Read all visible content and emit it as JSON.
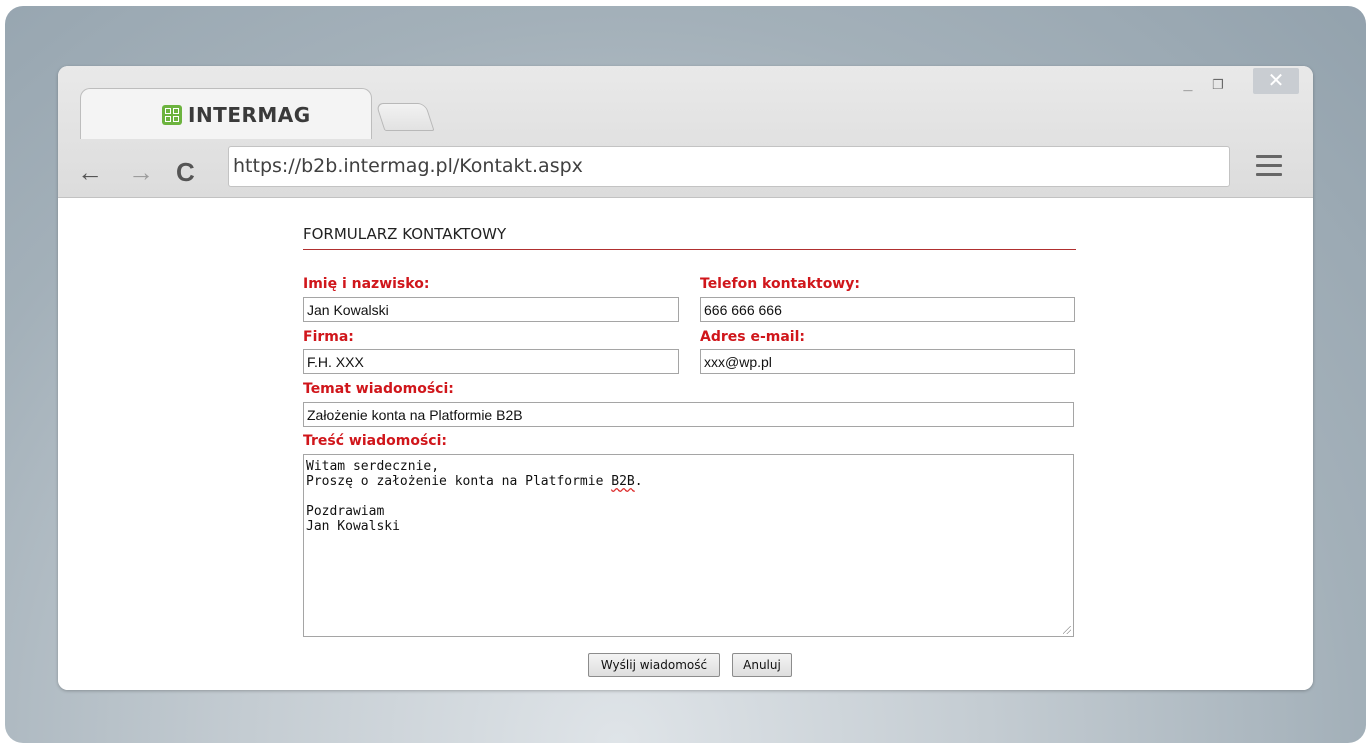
{
  "browser": {
    "tab_title": "INTERMAG",
    "url": "https://b2b.intermag.pl/Kontakt.aspx",
    "window_controls": {
      "minimize": "_",
      "maximize": "❐",
      "close": "✕"
    },
    "nav_icons": {
      "back": "←",
      "forward": "→",
      "reload": "C"
    }
  },
  "form": {
    "title": "FORMULARZ KONTAKTOWY",
    "fields": {
      "name": {
        "label": "Imię i nazwisko:",
        "value": "Jan Kowalski"
      },
      "phone": {
        "label": "Telefon kontaktowy:",
        "value": "666 666 666"
      },
      "company": {
        "label": "Firma:",
        "value": "F.H. XXX"
      },
      "email": {
        "label": "Adres e-mail:",
        "value": "xxx@wp.pl"
      },
      "subject": {
        "label": "Temat wiadomości:",
        "value": "Założenie konta na Platformie B2B"
      },
      "message": {
        "label": "Treść wiadomości:",
        "line1": "Witam serdecznie,",
        "line2_prefix": "Proszę o założenie konta na Platformie ",
        "line2_misspelled": "B2B",
        "line2_suffix": ".",
        "line3": "",
        "line4": "Pozdrawiam",
        "line5": "Jan Kowalski"
      }
    },
    "buttons": {
      "submit": "Wyślij wiadomość",
      "cancel": "Anuluj"
    }
  },
  "colors": {
    "accent": "#d0161b",
    "brand_green": "#6cb33e"
  }
}
